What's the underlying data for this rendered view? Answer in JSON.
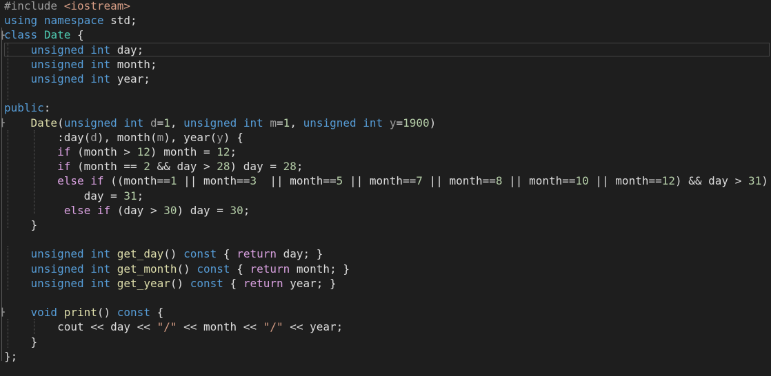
{
  "editor": {
    "colors": {
      "background": "#1e1e1e",
      "plain": "#dcdcdc",
      "keyword": "#569cd6",
      "control": "#d8a0df",
      "type": "#4ec9b0",
      "function": "#dcdcaa",
      "param": "#9a9a9a",
      "number": "#b5cea8",
      "string": "#d69d85",
      "preprocessor": "#9b9b9b"
    },
    "lines": [
      [
        {
          "t": "#include ",
          "c": "preprocessor"
        },
        {
          "t": "<iostream>",
          "c": "string"
        }
      ],
      [
        {
          "t": "using",
          "c": "keyword"
        },
        {
          "t": " ",
          "c": "plain"
        },
        {
          "t": "namespace",
          "c": "keyword"
        },
        {
          "t": " std;",
          "c": "plain"
        }
      ],
      [
        {
          "t": "class",
          "c": "keyword"
        },
        {
          "t": " ",
          "c": "plain"
        },
        {
          "t": "Date",
          "c": "type"
        },
        {
          "t": " {",
          "c": "plain"
        }
      ],
      [
        {
          "t": "    ",
          "c": "plain"
        },
        {
          "t": "unsigned",
          "c": "keyword"
        },
        {
          "t": " ",
          "c": "plain"
        },
        {
          "t": "int",
          "c": "keyword"
        },
        {
          "t": " day;",
          "c": "plain"
        }
      ],
      [
        {
          "t": "    ",
          "c": "plain"
        },
        {
          "t": "unsigned",
          "c": "keyword"
        },
        {
          "t": " ",
          "c": "plain"
        },
        {
          "t": "int",
          "c": "keyword"
        },
        {
          "t": " month;",
          "c": "plain"
        }
      ],
      [
        {
          "t": "    ",
          "c": "plain"
        },
        {
          "t": "unsigned",
          "c": "keyword"
        },
        {
          "t": " ",
          "c": "plain"
        },
        {
          "t": "int",
          "c": "keyword"
        },
        {
          "t": " year;",
          "c": "plain"
        }
      ],
      [],
      [
        {
          "t": "public",
          "c": "keyword"
        },
        {
          "t": ":",
          "c": "plain"
        }
      ],
      [
        {
          "t": "    ",
          "c": "plain"
        },
        {
          "t": "Date",
          "c": "function"
        },
        {
          "t": "(",
          "c": "plain"
        },
        {
          "t": "unsigned",
          "c": "keyword"
        },
        {
          "t": " ",
          "c": "plain"
        },
        {
          "t": "int",
          "c": "keyword"
        },
        {
          "t": " ",
          "c": "plain"
        },
        {
          "t": "d",
          "c": "param"
        },
        {
          "t": "=",
          "c": "plain"
        },
        {
          "t": "1",
          "c": "number"
        },
        {
          "t": ", ",
          "c": "plain"
        },
        {
          "t": "unsigned",
          "c": "keyword"
        },
        {
          "t": " ",
          "c": "plain"
        },
        {
          "t": "int",
          "c": "keyword"
        },
        {
          "t": " ",
          "c": "plain"
        },
        {
          "t": "m",
          "c": "param"
        },
        {
          "t": "=",
          "c": "plain"
        },
        {
          "t": "1",
          "c": "number"
        },
        {
          "t": ", ",
          "c": "plain"
        },
        {
          "t": "unsigned",
          "c": "keyword"
        },
        {
          "t": " ",
          "c": "plain"
        },
        {
          "t": "int",
          "c": "keyword"
        },
        {
          "t": " ",
          "c": "plain"
        },
        {
          "t": "y",
          "c": "param"
        },
        {
          "t": "=",
          "c": "plain"
        },
        {
          "t": "1900",
          "c": "number"
        },
        {
          "t": ")",
          "c": "plain"
        }
      ],
      [
        {
          "t": "        :day(",
          "c": "plain"
        },
        {
          "t": "d",
          "c": "param"
        },
        {
          "t": "), month(",
          "c": "plain"
        },
        {
          "t": "m",
          "c": "param"
        },
        {
          "t": "), year(",
          "c": "plain"
        },
        {
          "t": "y",
          "c": "param"
        },
        {
          "t": ") {",
          "c": "plain"
        }
      ],
      [
        {
          "t": "        ",
          "c": "plain"
        },
        {
          "t": "if",
          "c": "control"
        },
        {
          "t": " (month > ",
          "c": "plain"
        },
        {
          "t": "12",
          "c": "number"
        },
        {
          "t": ") month = ",
          "c": "plain"
        },
        {
          "t": "12",
          "c": "number"
        },
        {
          "t": ";",
          "c": "plain"
        }
      ],
      [
        {
          "t": "        ",
          "c": "plain"
        },
        {
          "t": "if",
          "c": "control"
        },
        {
          "t": " (month == ",
          "c": "plain"
        },
        {
          "t": "2",
          "c": "number"
        },
        {
          "t": " && day > ",
          "c": "plain"
        },
        {
          "t": "28",
          "c": "number"
        },
        {
          "t": ") day = ",
          "c": "plain"
        },
        {
          "t": "28",
          "c": "number"
        },
        {
          "t": ";",
          "c": "plain"
        }
      ],
      [
        {
          "t": "        ",
          "c": "plain"
        },
        {
          "t": "else",
          "c": "control"
        },
        {
          "t": " ",
          "c": "plain"
        },
        {
          "t": "if",
          "c": "control"
        },
        {
          "t": " ((month==",
          "c": "plain"
        },
        {
          "t": "1",
          "c": "number"
        },
        {
          "t": " || month==",
          "c": "plain"
        },
        {
          "t": "3",
          "c": "number"
        },
        {
          "t": "  || month==",
          "c": "plain"
        },
        {
          "t": "5",
          "c": "number"
        },
        {
          "t": " || month==",
          "c": "plain"
        },
        {
          "t": "7",
          "c": "number"
        },
        {
          "t": " || month==",
          "c": "plain"
        },
        {
          "t": "8",
          "c": "number"
        },
        {
          "t": " || month==",
          "c": "plain"
        },
        {
          "t": "10",
          "c": "number"
        },
        {
          "t": " || month==",
          "c": "plain"
        },
        {
          "t": "12",
          "c": "number"
        },
        {
          "t": ") && day > ",
          "c": "plain"
        },
        {
          "t": "31",
          "c": "number"
        },
        {
          "t": ")",
          "c": "plain"
        }
      ],
      [
        {
          "t": "            day = ",
          "c": "plain"
        },
        {
          "t": "31",
          "c": "number"
        },
        {
          "t": ";",
          "c": "plain"
        }
      ],
      [
        {
          "t": "         ",
          "c": "plain"
        },
        {
          "t": "else",
          "c": "control"
        },
        {
          "t": " ",
          "c": "plain"
        },
        {
          "t": "if",
          "c": "control"
        },
        {
          "t": " (day > ",
          "c": "plain"
        },
        {
          "t": "30",
          "c": "number"
        },
        {
          "t": ") day = ",
          "c": "plain"
        },
        {
          "t": "30",
          "c": "number"
        },
        {
          "t": ";",
          "c": "plain"
        }
      ],
      [
        {
          "t": "    }",
          "c": "plain"
        }
      ],
      [],
      [
        {
          "t": "    ",
          "c": "plain"
        },
        {
          "t": "unsigned",
          "c": "keyword"
        },
        {
          "t": " ",
          "c": "plain"
        },
        {
          "t": "int",
          "c": "keyword"
        },
        {
          "t": " ",
          "c": "plain"
        },
        {
          "t": "get_day",
          "c": "function"
        },
        {
          "t": "() ",
          "c": "plain"
        },
        {
          "t": "const",
          "c": "keyword"
        },
        {
          "t": " { ",
          "c": "plain"
        },
        {
          "t": "return",
          "c": "control"
        },
        {
          "t": " day; }",
          "c": "plain"
        }
      ],
      [
        {
          "t": "    ",
          "c": "plain"
        },
        {
          "t": "unsigned",
          "c": "keyword"
        },
        {
          "t": " ",
          "c": "plain"
        },
        {
          "t": "int",
          "c": "keyword"
        },
        {
          "t": " ",
          "c": "plain"
        },
        {
          "t": "get_month",
          "c": "function"
        },
        {
          "t": "() ",
          "c": "plain"
        },
        {
          "t": "const",
          "c": "keyword"
        },
        {
          "t": " { ",
          "c": "plain"
        },
        {
          "t": "return",
          "c": "control"
        },
        {
          "t": " month; }",
          "c": "plain"
        }
      ],
      [
        {
          "t": "    ",
          "c": "plain"
        },
        {
          "t": "unsigned",
          "c": "keyword"
        },
        {
          "t": " ",
          "c": "plain"
        },
        {
          "t": "int",
          "c": "keyword"
        },
        {
          "t": " ",
          "c": "plain"
        },
        {
          "t": "get_year",
          "c": "function"
        },
        {
          "t": "() ",
          "c": "plain"
        },
        {
          "t": "const",
          "c": "keyword"
        },
        {
          "t": " { ",
          "c": "plain"
        },
        {
          "t": "return",
          "c": "control"
        },
        {
          "t": " year; }",
          "c": "plain"
        }
      ],
      [],
      [
        {
          "t": "    ",
          "c": "plain"
        },
        {
          "t": "void",
          "c": "keyword"
        },
        {
          "t": " ",
          "c": "plain"
        },
        {
          "t": "print",
          "c": "function"
        },
        {
          "t": "() ",
          "c": "plain"
        },
        {
          "t": "const",
          "c": "keyword"
        },
        {
          "t": " {",
          "c": "plain"
        }
      ],
      [
        {
          "t": "        cout << day << ",
          "c": "plain"
        },
        {
          "t": "\"/\"",
          "c": "string"
        },
        {
          "t": " << month << ",
          "c": "plain"
        },
        {
          "t": "\"/\"",
          "c": "string"
        },
        {
          "t": " << year;",
          "c": "plain"
        }
      ],
      [
        {
          "t": "    }",
          "c": "plain"
        }
      ],
      [
        {
          "t": "};",
          "c": "plain"
        }
      ]
    ]
  }
}
